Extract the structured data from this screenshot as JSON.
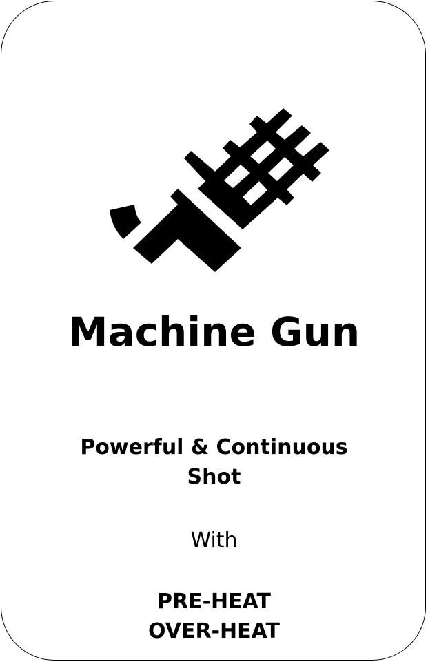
{
  "card": {
    "icon": "machine-gun-icon",
    "title": "Machine Gun",
    "description_line1": "Powerful & Continuous",
    "description_line2": "Shot",
    "connector": "With",
    "feature1": "PRE-HEAT",
    "feature2": "OVER-HEAT"
  }
}
